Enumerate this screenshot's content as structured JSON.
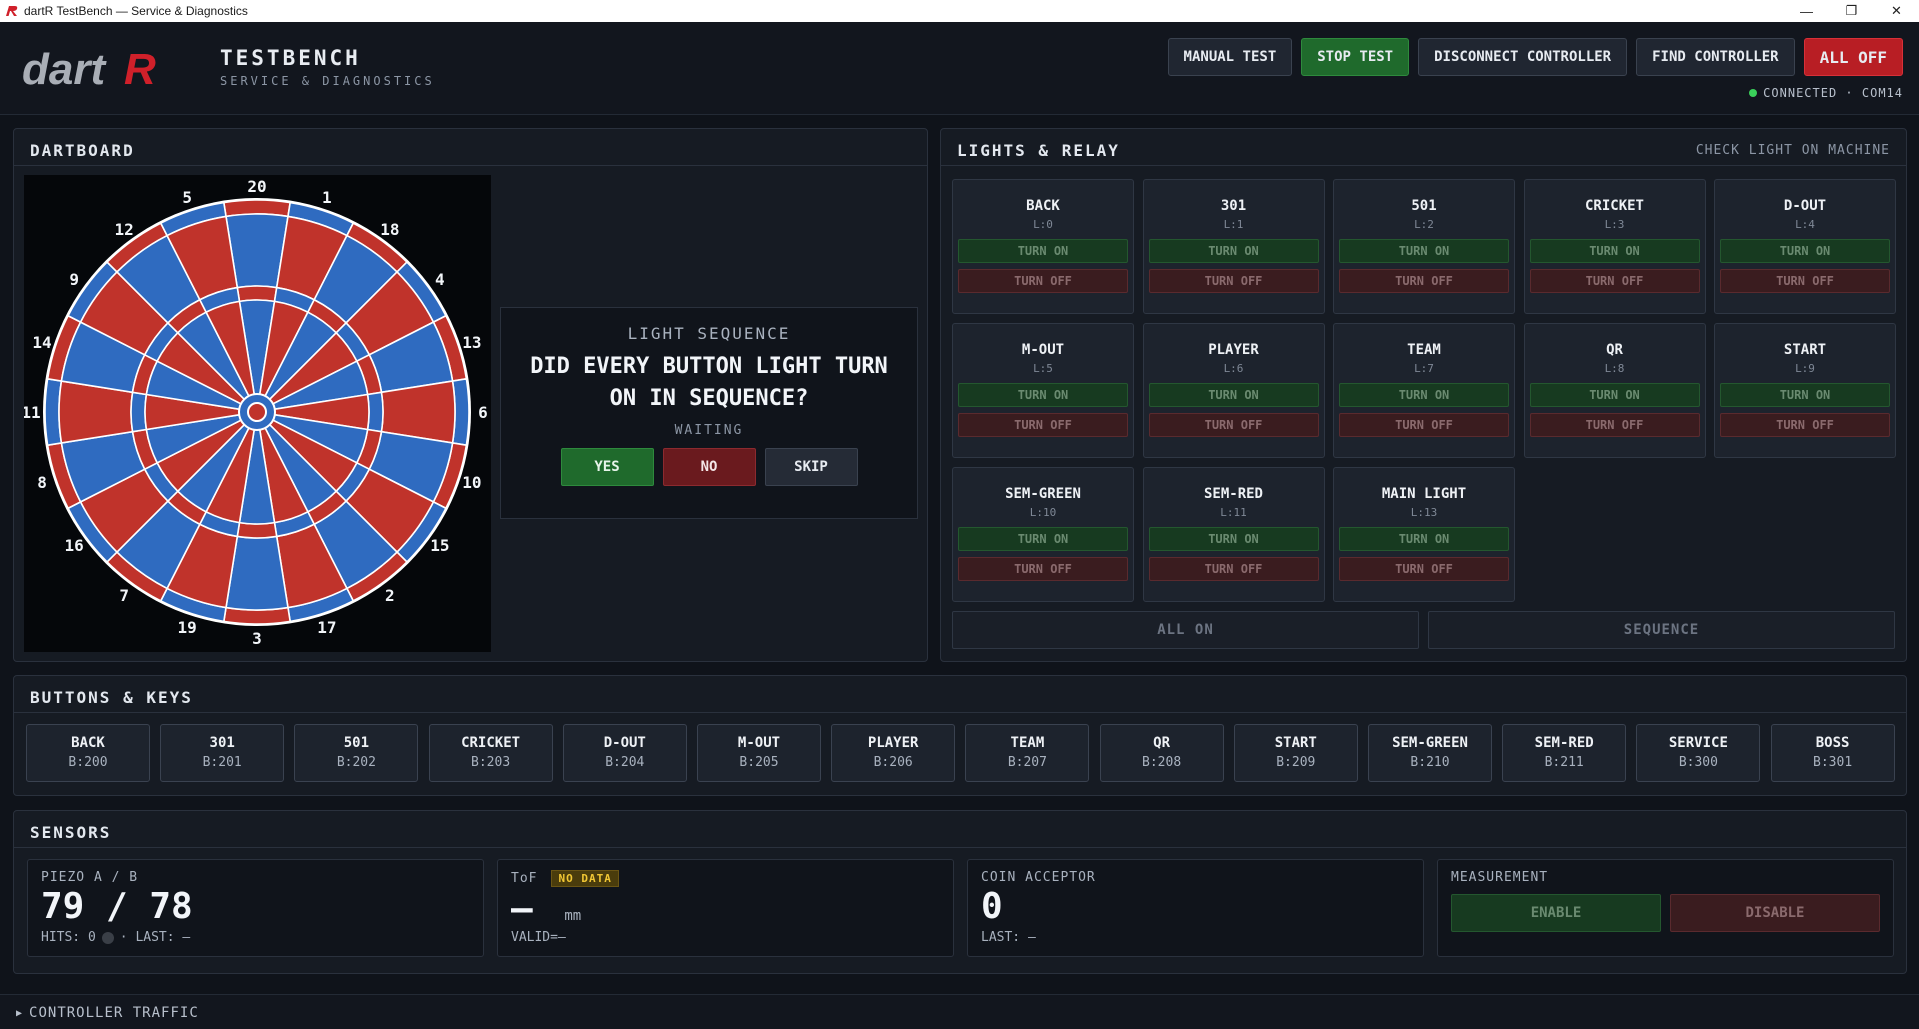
{
  "window": {
    "title": "dartR TestBench — Service & Diagnostics",
    "controls": [
      "—",
      "❐",
      "✕"
    ]
  },
  "header": {
    "logo_text": "dartR",
    "title": "TESTBENCH",
    "subtitle": "SERVICE & DIAGNOSTICS",
    "buttons": {
      "manual": "MANUAL TEST",
      "stop": "STOP TEST",
      "disconnect": "DISCONNECT CONTROLLER",
      "find": "FIND CONTROLLER",
      "all_off": "ALL OFF"
    },
    "connection": "CONNECTED · COM14"
  },
  "dartboard": {
    "title": "DARTBOARD",
    "numbers": [
      20,
      1,
      18,
      4,
      13,
      6,
      10,
      15,
      2,
      17,
      3,
      19,
      7,
      16,
      8,
      11,
      14,
      9,
      12,
      5
    ],
    "colors": {
      "red": "#c0332b",
      "blue": "#2f6bc0",
      "wire": "#ffffff"
    },
    "sequence": {
      "label": "LIGHT SEQUENCE",
      "question": "DID EVERY BUTTON LIGHT TURN ON IN SEQUENCE?",
      "status": "WAITING",
      "yes": "YES",
      "no": "NO",
      "skip": "SKIP"
    }
  },
  "lights": {
    "title": "LIGHTS & RELAY",
    "hint": "CHECK LIGHT ON MACHINE",
    "on_label": "TURN ON",
    "off_label": "TURN OFF",
    "items": [
      {
        "name": "BACK",
        "id": "L:0"
      },
      {
        "name": "301",
        "id": "L:1"
      },
      {
        "name": "501",
        "id": "L:2"
      },
      {
        "name": "CRICKET",
        "id": "L:3"
      },
      {
        "name": "D-OUT",
        "id": "L:4"
      },
      {
        "name": "M-OUT",
        "id": "L:5"
      },
      {
        "name": "PLAYER",
        "id": "L:6"
      },
      {
        "name": "TEAM",
        "id": "L:7"
      },
      {
        "name": "QR",
        "id": "L:8"
      },
      {
        "name": "START",
        "id": "L:9"
      },
      {
        "name": "SEM-GREEN",
        "id": "L:10"
      },
      {
        "name": "SEM-RED",
        "id": "L:11"
      },
      {
        "name": "MAIN LIGHT",
        "id": "L:13"
      }
    ],
    "all_on": "ALL ON",
    "sequence": "SEQUENCE"
  },
  "keys": {
    "title": "BUTTONS & KEYS",
    "items": [
      {
        "name": "BACK",
        "id": "B:200"
      },
      {
        "name": "301",
        "id": "B:201"
      },
      {
        "name": "501",
        "id": "B:202"
      },
      {
        "name": "CRICKET",
        "id": "B:203"
      },
      {
        "name": "D-OUT",
        "id": "B:204"
      },
      {
        "name": "M-OUT",
        "id": "B:205"
      },
      {
        "name": "PLAYER",
        "id": "B:206"
      },
      {
        "name": "TEAM",
        "id": "B:207"
      },
      {
        "name": "QR",
        "id": "B:208"
      },
      {
        "name": "START",
        "id": "B:209"
      },
      {
        "name": "SEM-GREEN",
        "id": "B:210"
      },
      {
        "name": "SEM-RED",
        "id": "B:211"
      },
      {
        "name": "SERVICE",
        "id": "B:300"
      },
      {
        "name": "BOSS",
        "id": "B:301"
      }
    ]
  },
  "sensors": {
    "title": "SENSORS",
    "piezo": {
      "label": "PIEZO A / B",
      "value": "79 / 78",
      "hits": "HITS: 0",
      "last": "· LAST: —"
    },
    "tof": {
      "label": "ToF",
      "badge": "NO DATA",
      "value": "—",
      "unit": "mm",
      "valid": "VALID=—"
    },
    "coin": {
      "label": "COIN ACCEPTOR",
      "value": "0",
      "last": "LAST: —"
    },
    "measurement": {
      "label": "MEASUREMENT",
      "enable": "ENABLE",
      "disable": "DISABLE"
    }
  },
  "traffic": {
    "label": "CONTROLLER TRAFFIC",
    "arrow": "▶"
  }
}
